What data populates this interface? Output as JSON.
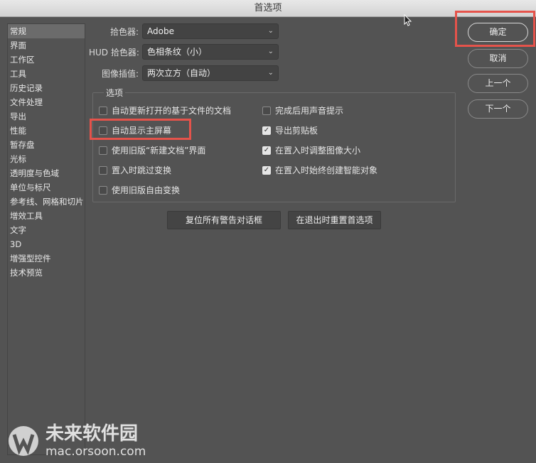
{
  "title": "首选项",
  "sidebar": {
    "items": [
      "常规",
      "界面",
      "工作区",
      "工具",
      "历史记录",
      "文件处理",
      "导出",
      "性能",
      "暂存盘",
      "光标",
      "透明度与色域",
      "单位与标尺",
      "参考线、网格和切片",
      "增效工具",
      "文字",
      "3D",
      "增强型控件",
      "技术预览"
    ],
    "selected": 0
  },
  "fields": [
    {
      "label": "拾色器:",
      "value": "Adobe"
    },
    {
      "label": "HUD 拾色器:",
      "value": "色相条纹（小）"
    },
    {
      "label": "图像插值:",
      "value": "两次立方（自动）"
    }
  ],
  "options": {
    "title": "选项",
    "left": [
      {
        "label": "自动更新打开的基于文件的文档",
        "checked": false
      },
      {
        "label": "自动显示主屏幕",
        "checked": false
      },
      {
        "label": "使用旧版“新建文档”界面",
        "checked": false
      },
      {
        "label": "置入时跳过变换",
        "checked": false
      },
      {
        "label": "使用旧版自由变换",
        "checked": false
      }
    ],
    "right": [
      {
        "label": "完成后用声音提示",
        "checked": false
      },
      {
        "label": "导出剪贴板",
        "checked": true
      },
      {
        "label": "在置入时调整图像大小",
        "checked": true
      },
      {
        "label": "在置入时始终创建智能对象",
        "checked": true
      }
    ]
  },
  "buttons": {
    "reset_warnings": "复位所有警告对话框",
    "reset_prefs": "在退出时重置首选项",
    "ok": "确定",
    "cancel": "取消",
    "prev": "上一个",
    "next": "下一个"
  },
  "watermark": {
    "brand": "未来软件园",
    "url": "mac.orsoon.com"
  },
  "colors": {
    "highlight": "#e5534b"
  }
}
